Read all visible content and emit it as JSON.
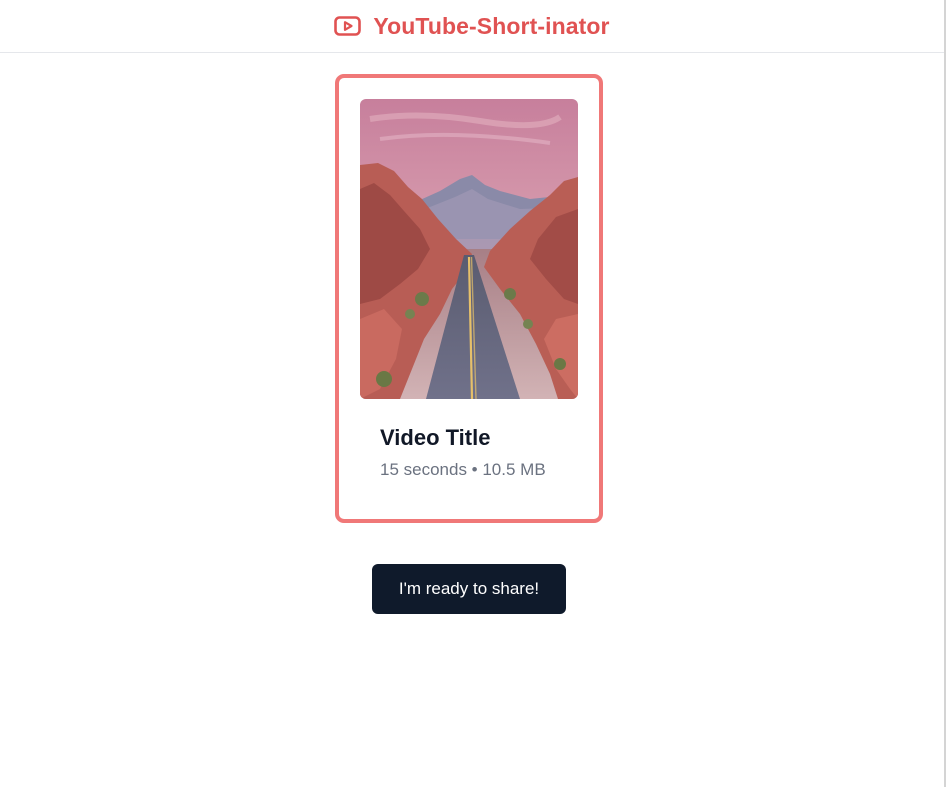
{
  "header": {
    "logo_icon": "youtube-play-icon",
    "title": "YouTube-Short-inator",
    "brand_color": "#e05252"
  },
  "video_card": {
    "thumbnail": "desert-road-canyon-image",
    "title": "Video Title",
    "meta": "15 seconds • 10.5 MB",
    "selected_border_color": "#f07878"
  },
  "actions": {
    "share_label": "I'm ready to share!"
  }
}
